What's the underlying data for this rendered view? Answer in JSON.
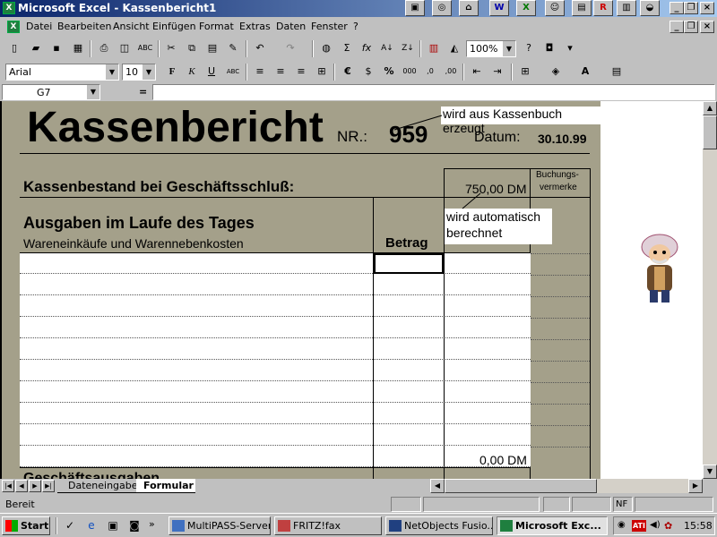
{
  "window": {
    "title": "Microsoft Excel - Kassenbericht1",
    "icon": "excel-icon"
  },
  "menu": [
    "Datei",
    "Bearbeiten",
    "Ansicht",
    "Einfügen",
    "Format",
    "Extras",
    "Daten",
    "Fenster",
    "?"
  ],
  "toolbar": {
    "zoom": "100%",
    "font_name": "Arial",
    "font_size": "10"
  },
  "formula_bar": {
    "name_box": "G7",
    "equals": "="
  },
  "sheet": {
    "title": "Kassenbericht",
    "nr_label": "NR.:",
    "nr_value": "959",
    "datum_label": "Datum:",
    "datum_value": "30.10.99",
    "callout_1": "wird aus Kassenbuch erzeugt",
    "callout_2_line1": "wird automatisch",
    "callout_2_line2": "berechnet",
    "kassenbestand_label": "Kassenbestand bei Geschäftsschluß:",
    "kassenbestand_value": "750,00 DM",
    "buchungs_line1": "Buchungs-",
    "buchungs_line2": "vermerke",
    "ausgaben_heading": "Ausgaben im Laufe des Tages",
    "ausgaben_sub": "Wareneinkäufe und Warennebenkosten",
    "betrag_header": "Betrag",
    "sum_value": "0,00 DM",
    "next_heading": "Geschäftsausgaben"
  },
  "tabs": [
    "Dateneingabe",
    "Formular"
  ],
  "status": {
    "text": "Bereit",
    "nf": "NF"
  },
  "taskbar": {
    "start": "Start",
    "tasks": [
      "MultiPASS-Server",
      "FRITZ!fax",
      "NetObjects Fusio...",
      "Microsoft Exc..."
    ],
    "clock": "15:58"
  },
  "colors": {
    "sheet_bg": "#a4a08a",
    "titlebar": "#0a246a"
  }
}
